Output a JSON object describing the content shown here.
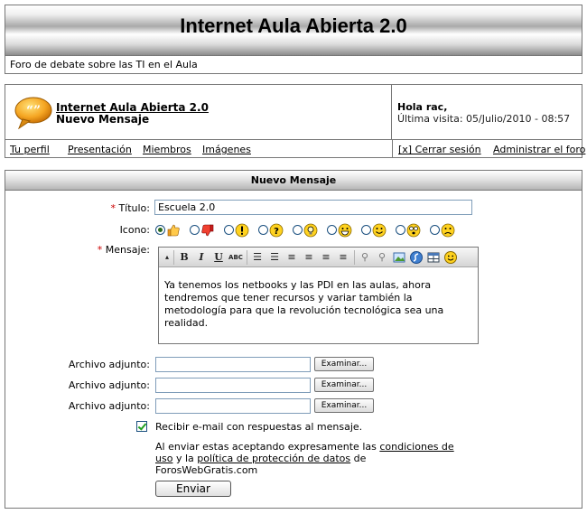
{
  "header": {
    "title": "Internet Aula Abierta 2.0",
    "tagline": "Foro de debate sobre las TI en el Aula"
  },
  "forum": {
    "name": "Internet Aula Abierta 2.0",
    "subtitle": "Nuevo Mensaje",
    "icon": "speech-bubble-icon"
  },
  "user": {
    "greeting": "Hola",
    "name": "rac",
    "last_visit": "Última visita: 05/Julio/2010 - 08:57"
  },
  "nav": {
    "left": [
      "Tu perfil",
      "Presentación",
      "Miembros",
      "Imágenes"
    ],
    "right": [
      "[x] Cerrar sesión",
      "Administrar el foro"
    ]
  },
  "form": {
    "heading": "Nuevo Mensaje",
    "title_label": "Título:",
    "title_value": "Escuela 2.0",
    "icon_label": "Icono:",
    "icons": [
      {
        "name": "thumbs-up-icon",
        "selected": true
      },
      {
        "name": "thumbs-down-icon",
        "selected": false
      },
      {
        "name": "exclamation-icon",
        "selected": false
      },
      {
        "name": "question-icon",
        "selected": false
      },
      {
        "name": "lightbulb-icon",
        "selected": false
      },
      {
        "name": "laughing-smiley-icon",
        "selected": false
      },
      {
        "name": "smile-icon",
        "selected": false
      },
      {
        "name": "surprised-smiley-icon",
        "selected": false
      },
      {
        "name": "sad-smiley-icon",
        "selected": false
      }
    ],
    "message_label": "Mensaje:",
    "message_text": "Ya tenemos los netbooks y las PDI en las aulas, ahora tendremos que tener recursos y variar también la metodología para que la revolución tecnológica sea una realidad.",
    "toolbar": {
      "bold": "B",
      "italic": "I",
      "underline": "U",
      "spellcheck": "ABC"
    },
    "attachments": [
      {
        "label": "Archivo adjunto:",
        "button": "Examinar..."
      },
      {
        "label": "Archivo adjunto:",
        "button": "Examinar..."
      },
      {
        "label": "Archivo adjunto:",
        "button": "Examinar..."
      }
    ],
    "notify_checked": true,
    "notify_label": "Recibir e-mail con respuestas al mensaje.",
    "legal_prefix": "Al enviar estas aceptando expresamente las",
    "terms_link": "condiciones de uso",
    "legal_and": "y la",
    "privacy_link": "política de protección de datos",
    "legal_suffix": "de ForosWebGratis.com",
    "submit_label": "Enviar"
  },
  "colors": {
    "required": "#cc0000",
    "border": "#777777",
    "checkbox_tick": "#21a121"
  }
}
